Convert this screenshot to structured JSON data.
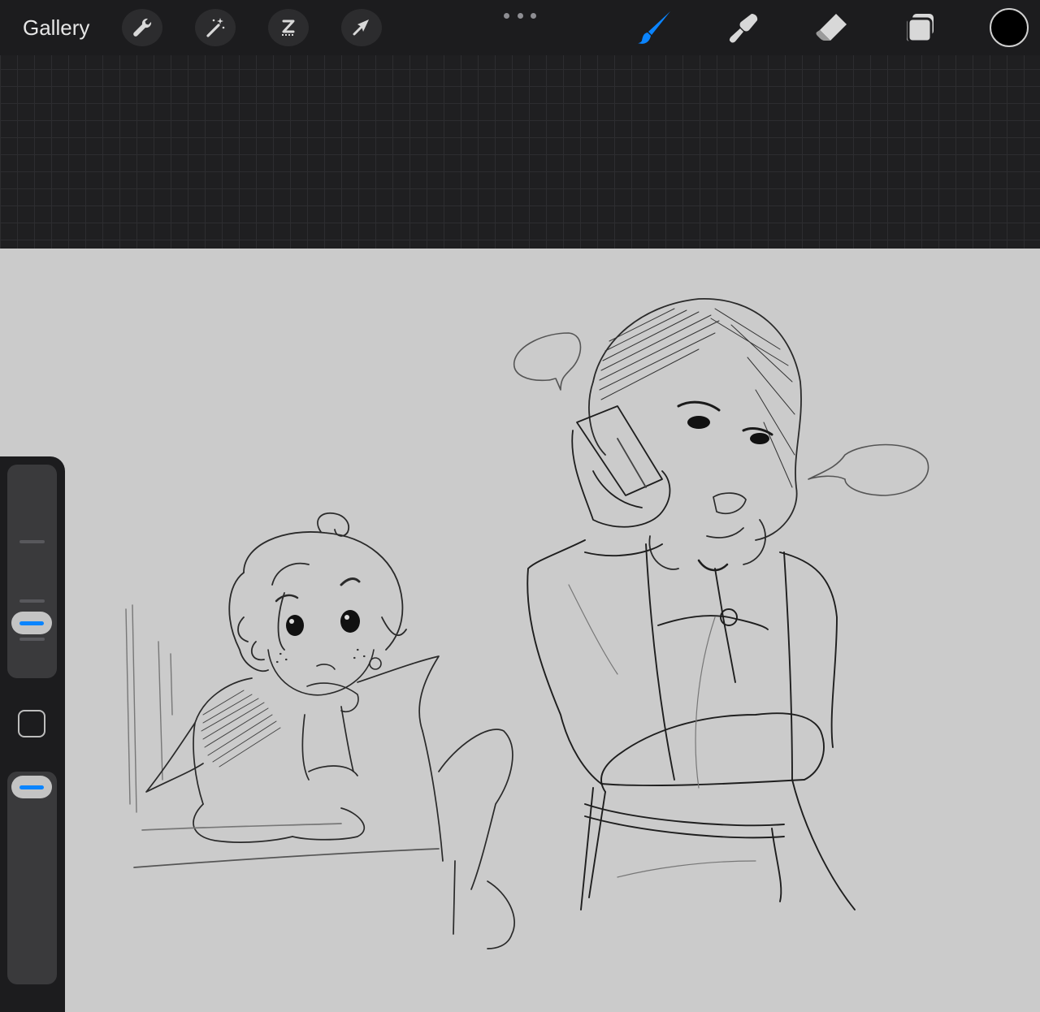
{
  "toolbar": {
    "gallery_label": "Gallery",
    "left_tools": [
      {
        "icon": "wrench-icon",
        "name": "actions"
      },
      {
        "icon": "magic-wand-icon",
        "name": "adjustments"
      },
      {
        "icon": "selection-icon",
        "name": "selection"
      },
      {
        "icon": "transform-arrow-icon",
        "name": "transform"
      }
    ],
    "right_tools": [
      {
        "icon": "brush-icon",
        "name": "paint",
        "active": true
      },
      {
        "icon": "smudge-icon",
        "name": "smudge",
        "active": false
      },
      {
        "icon": "eraser-icon",
        "name": "erase",
        "active": false
      },
      {
        "icon": "layers-icon",
        "name": "layers",
        "active": false
      }
    ],
    "current_color": "#000000"
  },
  "sidebar": {
    "brush_size_slider": {
      "icon": "size-slider"
    },
    "opacity_slider": {
      "icon": "opacity-slider"
    },
    "modify_button": {
      "icon": "square-icon"
    }
  },
  "colors": {
    "accent": "#0a84ff",
    "toolbar_bg": "#1c1c1e",
    "canvas_bg": "#cbcbcb"
  }
}
